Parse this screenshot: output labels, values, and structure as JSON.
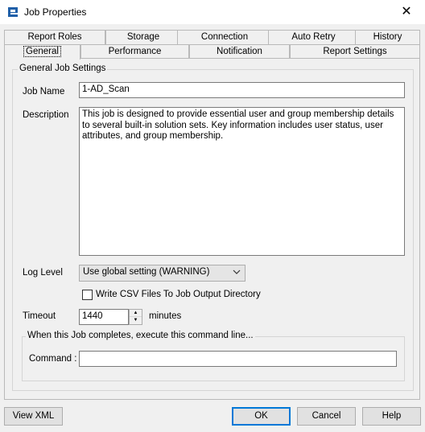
{
  "window": {
    "title": "Job Properties",
    "close_glyph": "✕"
  },
  "tabs_top": [
    {
      "label": "Report Roles"
    },
    {
      "label": "Storage"
    },
    {
      "label": "Connection"
    },
    {
      "label": "Auto Retry"
    },
    {
      "label": "History"
    }
  ],
  "tabs_bottom": [
    {
      "label": "General",
      "active": true
    },
    {
      "label": "Performance"
    },
    {
      "label": "Notification"
    },
    {
      "label": "Report Settings"
    }
  ],
  "general": {
    "group_title": "General Job Settings",
    "job_name_label": "Job Name",
    "job_name_value": "1-AD_Scan",
    "description_label": "Description",
    "description_value": "This job is designed to provide essential user and group membership details to several built-in solution sets. Key information includes user status, user attributes, and group membership.",
    "log_level_label": "Log Level",
    "log_level_value": "Use global setting (WARNING)",
    "write_csv_label": "Write CSV Files To Job Output Directory",
    "write_csv_checked": false,
    "timeout_label": "Timeout",
    "timeout_value": "1440",
    "timeout_unit": "minutes",
    "command_group_title": "When this Job completes, execute this command line...",
    "command_label": "Command :",
    "command_value": ""
  },
  "footer": {
    "view_xml": "View XML",
    "ok": "OK",
    "cancel": "Cancel",
    "help": "Help"
  },
  "colors": {
    "accent": "#0078d7",
    "app_icon": "#1f5fa8"
  }
}
